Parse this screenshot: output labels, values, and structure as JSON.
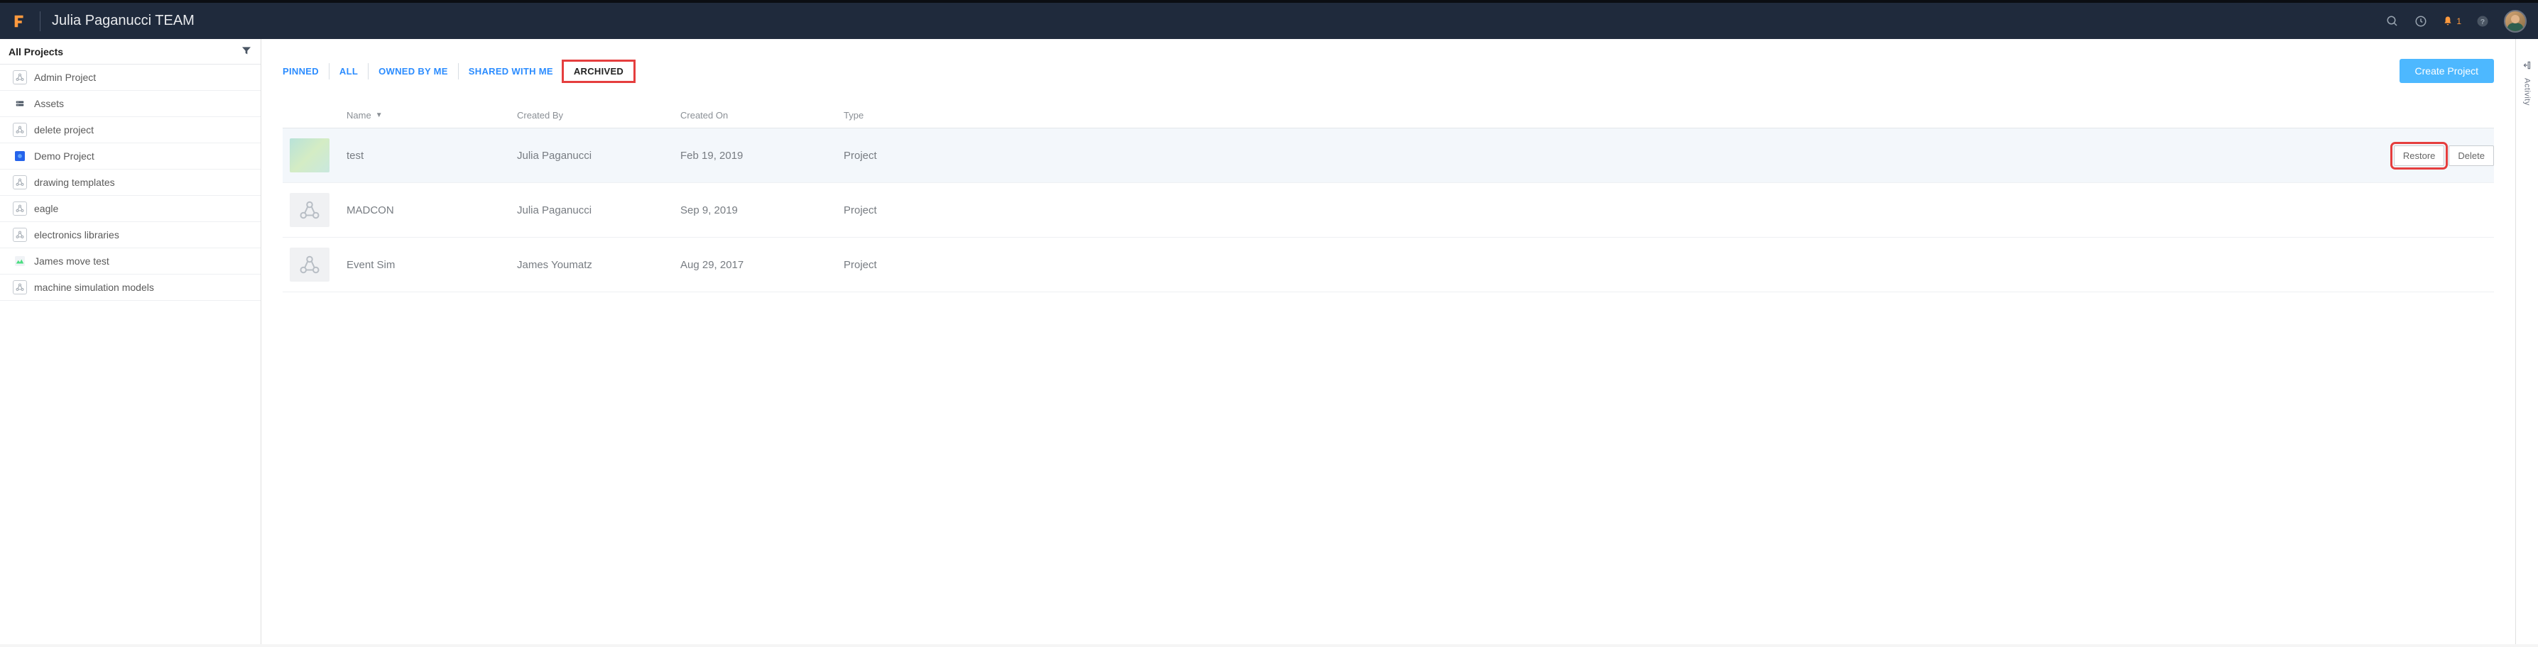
{
  "header": {
    "team_name": "Julia Paganucci TEAM",
    "notification_count": "1"
  },
  "sidebar": {
    "title": "All Projects",
    "items": [
      {
        "label": "Admin Project",
        "icon": "tri"
      },
      {
        "label": "Assets",
        "icon": "drive"
      },
      {
        "label": "delete project",
        "icon": "tri"
      },
      {
        "label": "Demo Project",
        "icon": "blue"
      },
      {
        "label": "drawing templates",
        "icon": "tri"
      },
      {
        "label": "eagle",
        "icon": "tri"
      },
      {
        "label": "electronics libraries",
        "icon": "tri"
      },
      {
        "label": "James move test",
        "icon": "green"
      },
      {
        "label": "machine simulation models",
        "icon": "tri"
      }
    ]
  },
  "tabs": {
    "pinned": "PINNED",
    "all": "ALL",
    "owned": "OWNED BY ME",
    "shared": "SHARED WITH ME",
    "archived": "ARCHIVED"
  },
  "buttons": {
    "create_project": "Create Project",
    "restore": "Restore",
    "delete": "Delete"
  },
  "columns": {
    "name": "Name",
    "created_by": "Created By",
    "created_on": "Created On",
    "type": "Type"
  },
  "rows": [
    {
      "name": "test",
      "created_by": "Julia Paganucci",
      "created_on": "Feb 19, 2019",
      "type": "Project",
      "thumb": "im",
      "selected": true
    },
    {
      "name": "MADCON",
      "created_by": "Julia Paganucci",
      "created_on": "Sep 9, 2019",
      "type": "Project",
      "thumb": "ph",
      "selected": false
    },
    {
      "name": "Event Sim",
      "created_by": "James Youmatz",
      "created_on": "Aug 29, 2017",
      "type": "Project",
      "thumb": "ph",
      "selected": false
    }
  ],
  "rail": {
    "label": "Activity"
  }
}
